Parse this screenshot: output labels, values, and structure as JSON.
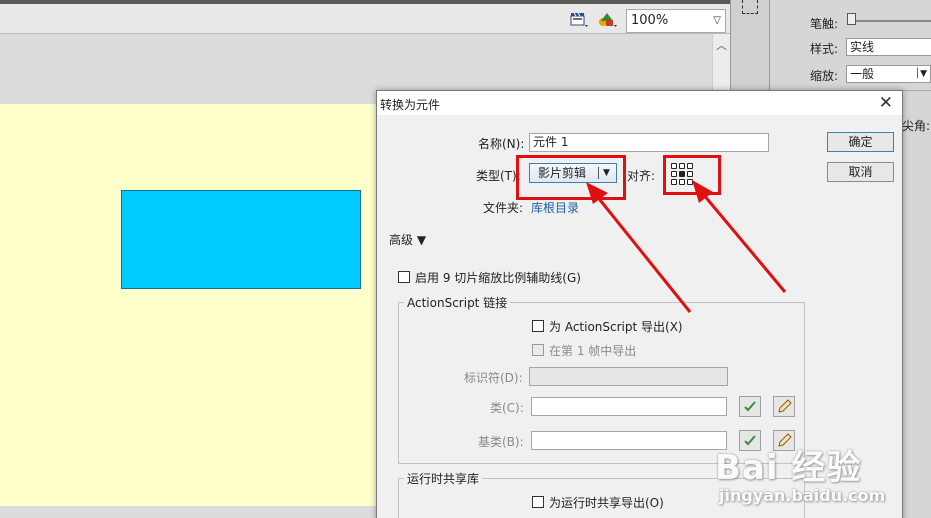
{
  "toolbar": {
    "zoom_value": "100%",
    "scene_icon": "clapper-scene-icon",
    "symbol_icon": "edit-symbols-icon"
  },
  "properties": {
    "stroke_label": "笔触:",
    "style_label": "样式:",
    "style_value": "实线",
    "scale_label": "缩放:",
    "scale_value": "一般",
    "corner_label": "尖角:"
  },
  "dialog": {
    "title": "转换为元件",
    "close_glyph": "✕",
    "name_label": "名称(N):",
    "name_value": "元件 1",
    "type_label": "类型(T):",
    "type_value": "影片剪辑",
    "align_label": "对齐:",
    "folder_label": "文件夹:",
    "folder_value": "库根目录",
    "ok_label": "确定",
    "cancel_label": "取消",
    "advanced_label": "高级 ▼",
    "enable_9slice_label": "启用 9 切片缩放比例辅助线(G)",
    "actionscript_legend": "ActionScript 链接",
    "export_as_label": "为 ActionScript 导出(X)",
    "export_frame1_label": "在第 1 帧中导出",
    "identifier_label": "标识符(D):",
    "class_label": "类(C):",
    "base_class_label": "基类(B):",
    "runtime_legend": "运行时共享库",
    "runtime_export_label": "为运行时共享导出(O)"
  },
  "colors": {
    "stage_bg": "#ffffcc",
    "shape_fill": "#00ccff",
    "annotation_red": "#e01010",
    "link_blue": "#1f5fa6"
  },
  "watermark": {
    "main": "Bai 经验",
    "sub": "jingyan.baidu.com"
  }
}
